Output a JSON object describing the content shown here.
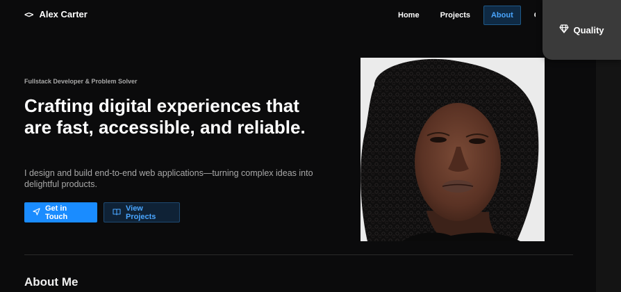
{
  "header": {
    "brand_name": "Alex Carter",
    "brand_icon": "code-icon",
    "nav": [
      {
        "label": "Home",
        "active": false
      },
      {
        "label": "Projects",
        "active": false
      },
      {
        "label": "About",
        "active": true
      },
      {
        "label": "Contact",
        "active": false
      }
    ]
  },
  "badge": {
    "icon": "gem-icon",
    "label": "Quality"
  },
  "hero": {
    "eyebrow": "Fullstack Developer & Problem Solver",
    "headline": "Crafting digital experiences that are fast, accessible, and reliable.",
    "lead": "I design and build end-to-end web applications—turning complex ideas into delightful products.",
    "primary_button": {
      "label": "Get in Touch",
      "icon": "send-icon"
    },
    "secondary_button": {
      "label": "View Projects",
      "icon": "book-icon"
    }
  },
  "about": {
    "title": "About Me"
  },
  "colors": {
    "background": "#0b0b0c",
    "accent": "#1a8cff",
    "accent_text": "#4aa6ff",
    "badge_bg": "#3a3a3a"
  }
}
